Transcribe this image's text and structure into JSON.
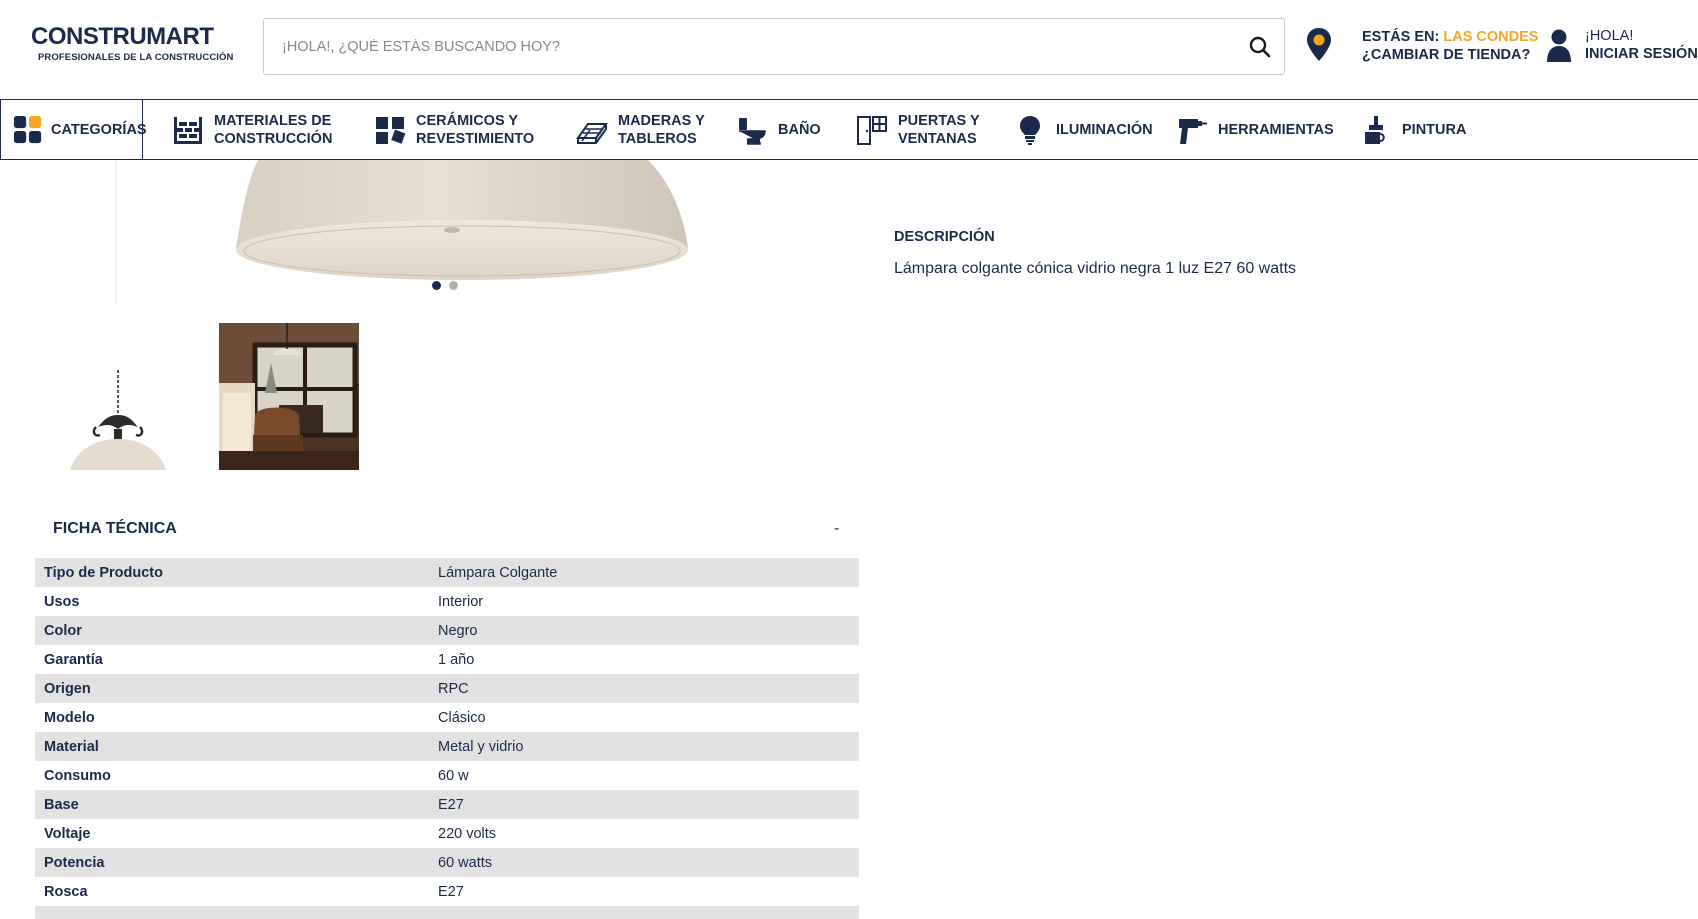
{
  "header": {
    "logo_text": "CONSTRUMART",
    "logo_tagline": "PROFESIONALES DE LA CONSTRUCCIÓN",
    "search_placeholder": "¡HOLA!, ¿QUÉ ESTÁS BUSCANDO HOY?",
    "store_prefix": "ESTÁS EN:",
    "store_name": "LAS CONDES",
    "store_change": "¿CAMBIAR DE TIENDA?",
    "greeting": "¡HOLA!",
    "login": "INICIAR SESIÓN",
    "accent_color": "#f5a623",
    "brand_color": "#1b2a4a"
  },
  "nav": {
    "categories": "CATEGORÍAS",
    "items": [
      {
        "line1": "MATERIALES DE",
        "line2": "CONSTRUCCIÓN",
        "icon": "bricks-icon"
      },
      {
        "line1": "CERÁMICOS Y",
        "line2": "REVESTIMIENTO",
        "icon": "tiles-icon"
      },
      {
        "line1": "MADERAS Y",
        "line2": "TABLEROS",
        "icon": "wood-icon"
      },
      {
        "line1": "BAÑO",
        "line2": "",
        "icon": "toilet-icon"
      },
      {
        "line1": "PUERTAS Y",
        "line2": "VENTANAS",
        "icon": "door-window-icon"
      },
      {
        "line1": "ILUMINACIÓN",
        "line2": "",
        "icon": "bulb-icon"
      },
      {
        "line1": "HERRAMIENTAS",
        "line2": "",
        "icon": "drill-icon"
      },
      {
        "line1": "PINTURA",
        "line2": "",
        "icon": "paint-icon"
      }
    ]
  },
  "product": {
    "description_title": "DESCRIPCIÓN",
    "description_text": "Lámpara colgante cónica vidrio negra 1 luz E27 60 watts"
  },
  "ficha": {
    "title": "FICHA TÉCNICA",
    "toggle": "-",
    "rows": [
      {
        "key": "Tipo de Producto",
        "value": "Lámpara Colgante"
      },
      {
        "key": "Usos",
        "value": "Interior"
      },
      {
        "key": "Color",
        "value": "Negro"
      },
      {
        "key": "Garantía",
        "value": "1 año"
      },
      {
        "key": "Origen",
        "value": "RPC"
      },
      {
        "key": "Modelo",
        "value": "Clásico"
      },
      {
        "key": "Material",
        "value": "Metal y vidrio"
      },
      {
        "key": "Consumo",
        "value": "60 w"
      },
      {
        "key": "Base",
        "value": "E27"
      },
      {
        "key": "Voltaje",
        "value": "220 volts"
      },
      {
        "key": "Potencia",
        "value": "60 watts"
      },
      {
        "key": "Rosca",
        "value": "E27"
      }
    ]
  }
}
